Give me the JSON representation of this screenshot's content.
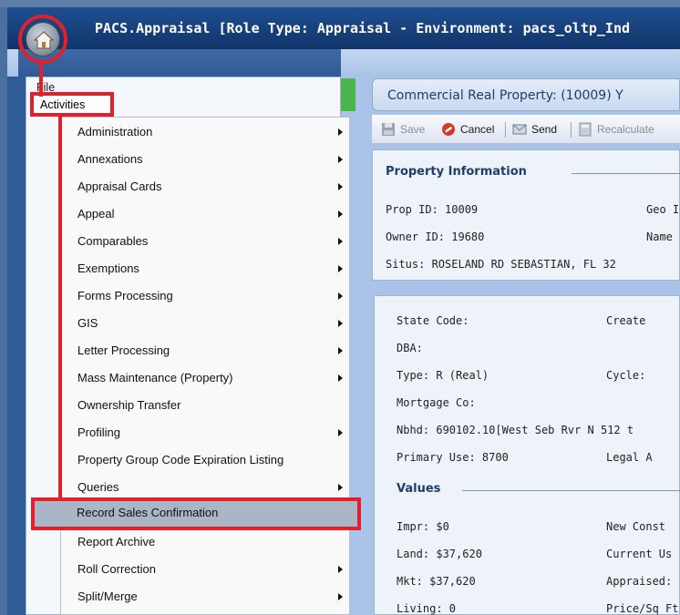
{
  "window": {
    "title": "PACS.Appraisal [Role Type: Appraisal - Environment: pacs_oltp_Ind"
  },
  "app_menu": {
    "items": [
      {
        "label": "File"
      },
      {
        "label": "Activities"
      }
    ]
  },
  "activities_menu": {
    "items": [
      {
        "label": "Administration",
        "submenu": true
      },
      {
        "label": "Annexations",
        "submenu": true
      },
      {
        "label": "Appraisal Cards",
        "submenu": true
      },
      {
        "label": "Appeal",
        "submenu": true
      },
      {
        "label": "Comparables",
        "submenu": true
      },
      {
        "label": "Exemptions",
        "submenu": true
      },
      {
        "label": "Forms Processing",
        "submenu": true
      },
      {
        "label": "GIS",
        "submenu": true
      },
      {
        "label": "Letter Processing",
        "submenu": true
      },
      {
        "label": "Mass Maintenance (Property)",
        "submenu": true
      },
      {
        "label": "Ownership Transfer",
        "submenu": false
      },
      {
        "label": "Profiling",
        "submenu": true
      },
      {
        "label": "Property Group Code Expiration Listing",
        "submenu": false
      },
      {
        "label": "Queries",
        "submenu": true
      },
      {
        "label": "Record Sales Confirmation",
        "submenu": false,
        "highlighted": true
      },
      {
        "label": "Report Archive",
        "submenu": false
      },
      {
        "label": "Roll Correction",
        "submenu": true
      },
      {
        "label": "Split/Merge",
        "submenu": true
      }
    ]
  },
  "record": {
    "title": "Commercial Real Property: (10009) Y"
  },
  "toolbar": {
    "save": "Save",
    "cancel": "Cancel",
    "send": "Send",
    "recalculate": "Recalculate"
  },
  "property_info": {
    "title": "Property Information",
    "prop_id": "Prop ID: 10009",
    "geo": "Geo I",
    "owner_id": "Owner ID: 19680",
    "name": "Name",
    "situs": "Situs: ROSELAND RD  SEBASTIAN, FL 32"
  },
  "details": {
    "state_code": "State Code:",
    "create": "Create",
    "dba": "DBA:",
    "type": "Type: R (Real)",
    "cycle": "Cycle:",
    "mortgage": "Mortgage Co:",
    "nbhd": "Nbhd: 690102.10[West Seb Rvr N 512 t",
    "primary_use": "Primary Use: 8700",
    "legal": "Legal A"
  },
  "values": {
    "title": "Values",
    "impr": "Impr:  $0",
    "new_const": "New Const",
    "land": "Land:  $37,620",
    "current_use": "Current Us",
    "mkt": "Mkt:   $37,620",
    "appraised": "Appraised:",
    "living": "Living: 0",
    "price_sqft": "Price/Sq Ft"
  },
  "colors": {
    "annotation": "#e2202b",
    "title_bar": "#163f78",
    "section_title": "#1e3d6b",
    "menu_highlight": "#aab6c6"
  }
}
